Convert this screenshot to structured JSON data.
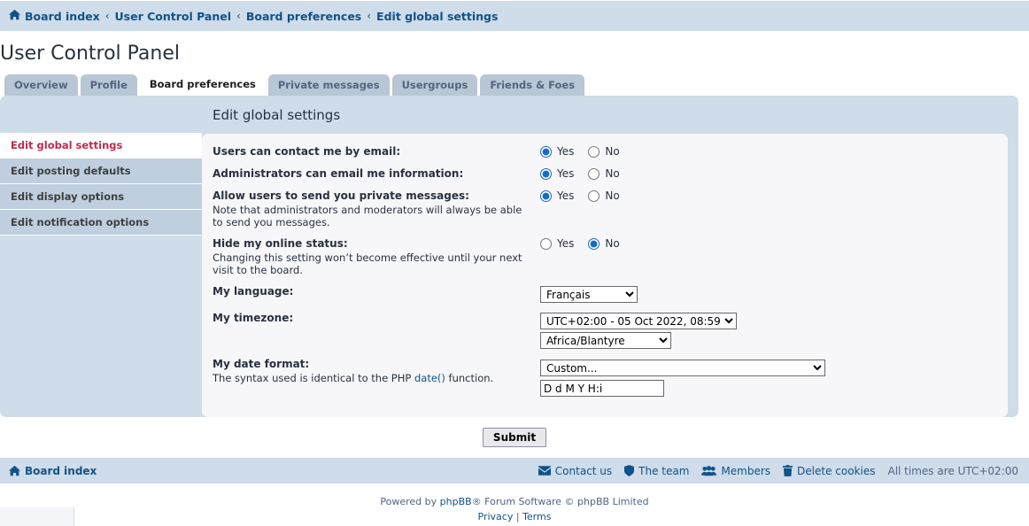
{
  "breadcrumb": {
    "home_icon": "home-icon",
    "items": [
      {
        "label": "Board index"
      },
      {
        "label": "User Control Panel"
      },
      {
        "label": "Board preferences"
      },
      {
        "label": "Edit global settings"
      }
    ],
    "separator": "‹"
  },
  "page": {
    "title": "User Control Panel"
  },
  "tabs": [
    {
      "label": "Overview",
      "active": false
    },
    {
      "label": "Profile",
      "active": false
    },
    {
      "label": "Board preferences",
      "active": true
    },
    {
      "label": "Private messages",
      "active": false
    },
    {
      "label": "Usergroups",
      "active": false
    },
    {
      "label": "Friends & Foes",
      "active": false
    }
  ],
  "sidebar": {
    "items": [
      {
        "label": "Edit global settings",
        "active": true
      },
      {
        "label": "Edit posting defaults",
        "active": false
      },
      {
        "label": "Edit display options",
        "active": false
      },
      {
        "label": "Edit notification options",
        "active": false
      }
    ]
  },
  "content": {
    "heading": "Edit global settings",
    "yes_label": "Yes",
    "no_label": "No",
    "fields": {
      "contact_email": {
        "label": "Users can contact me by email:",
        "value": "yes"
      },
      "admin_email": {
        "label": "Administrators can email me information:",
        "value": "yes"
      },
      "allow_pm": {
        "label": "Allow users to send you private messages:",
        "desc": "Note that administrators and moderators will always be able to send you messages.",
        "value": "yes"
      },
      "hide_online": {
        "label": "Hide my online status:",
        "desc": "Changing this setting won’t become effective until your next visit to the board.",
        "value": "no"
      },
      "language": {
        "label": "My language:",
        "value": "Français"
      },
      "timezone": {
        "label": "My timezone:",
        "value": "UTC+02:00 - 05 Oct 2022, 08:59",
        "name_value": "Africa/Blantyre"
      },
      "date_format": {
        "label": "My date format:",
        "desc_prefix": "The syntax used is identical to the PHP ",
        "desc_link": "date()",
        "desc_suffix": " function.",
        "select_value": "Custom...",
        "custom_value": "D d M Y H:i"
      }
    },
    "submit_label": "Submit"
  },
  "footer": {
    "board_index": "Board index",
    "links": [
      {
        "label": "Contact us",
        "icon": "envelope-icon"
      },
      {
        "label": "The team",
        "icon": "shield-icon"
      },
      {
        "label": "Members",
        "icon": "people-icon"
      },
      {
        "label": "Delete cookies",
        "icon": "trash-icon"
      }
    ],
    "times": "All times are UTC+02:00"
  },
  "copyright": {
    "powered_prefix": "Powered by ",
    "phpbb": "phpBB",
    "powered_suffix": "® Forum Software © phpBB Limited",
    "privacy": "Privacy",
    "divider": "|",
    "terms": "Terms"
  },
  "colors": {
    "accent_blue": "#105289",
    "panel_blue": "#cfdce9",
    "active_red": "#bc2a4d",
    "tab_inactive": "#b8c6d5",
    "radio_blue": "#1569c7"
  }
}
